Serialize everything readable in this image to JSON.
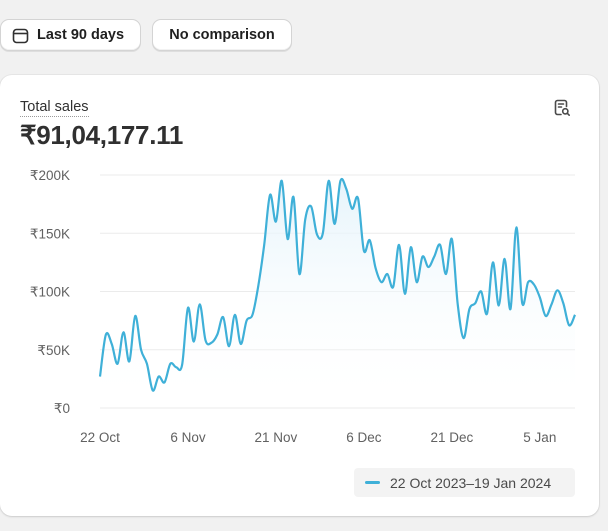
{
  "toolbar": {
    "date_range_label": "Last 90 days",
    "date_range_icon": "calendar-icon",
    "comparison_label": "No comparison"
  },
  "card": {
    "metric_label": "Total sales",
    "metric_value": "₹91,04,177.11",
    "explore_icon": "data-explore-icon"
  },
  "legend": {
    "label": "22 Oct 2023–19 Jan 2024"
  },
  "colors": {
    "line": "#3fb0d8",
    "area_top": "#e4f3fb",
    "grid": "#ebebeb",
    "axis_text": "#616161"
  },
  "chart_data": {
    "type": "area",
    "title": "",
    "xlabel": "",
    "ylabel": "",
    "ylim": [
      0,
      200000
    ],
    "grid": true,
    "legend_placement": "bottom-right",
    "y_ticks": [
      {
        "value": 0,
        "label": "₹0"
      },
      {
        "value": 50000,
        "label": "₹50K"
      },
      {
        "value": 100000,
        "label": "₹100K"
      },
      {
        "value": 150000,
        "label": "₹150K"
      },
      {
        "value": 200000,
        "label": "₹200K"
      }
    ],
    "x_ticks": [
      {
        "index": 0,
        "label": "22 Oct"
      },
      {
        "index": 15,
        "label": "6 Nov"
      },
      {
        "index": 30,
        "label": "21 Nov"
      },
      {
        "index": 45,
        "label": "6 Dec"
      },
      {
        "index": 60,
        "label": "21 Dec"
      },
      {
        "index": 75,
        "label": "5 Jan"
      }
    ],
    "series": [
      {
        "name": "22 Oct 2023–19 Jan 2024",
        "values": [
          27000,
          63000,
          55000,
          38000,
          65000,
          40000,
          79000,
          50000,
          38000,
          15000,
          27000,
          22000,
          38000,
          35000,
          37000,
          86000,
          57000,
          89000,
          58000,
          56000,
          63000,
          78000,
          53000,
          80000,
          55000,
          75000,
          80000,
          105000,
          140000,
          183000,
          160000,
          195000,
          145000,
          181000,
          115000,
          162000,
          173000,
          149000,
          150000,
          195000,
          158000,
          195000,
          188000,
          171000,
          180000,
          135000,
          144000,
          120000,
          108000,
          115000,
          104000,
          140000,
          98000,
          138000,
          108000,
          130000,
          121000,
          130000,
          140000,
          115000,
          145000,
          89000,
          60000,
          85000,
          90000,
          100000,
          81000,
          125000,
          88000,
          128000,
          85000,
          155000,
          90000,
          108000,
          106000,
          95000,
          79000,
          89000,
          101000,
          90000,
          71000,
          80000
        ]
      }
    ]
  }
}
